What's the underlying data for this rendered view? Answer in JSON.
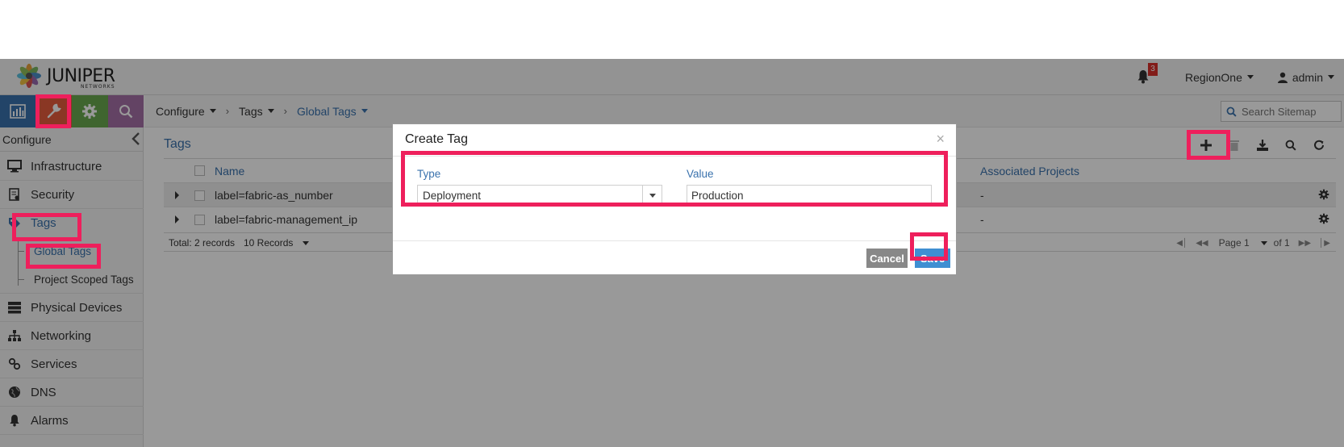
{
  "header": {
    "brand": "JUNIPER",
    "brand_sub": "NETWORKS",
    "notification_count": "3",
    "region": "RegionOne",
    "user": "admin"
  },
  "sidebar": {
    "title": "Configure",
    "items": [
      {
        "label": "Infrastructure",
        "icon": "monitor-icon"
      },
      {
        "label": "Security",
        "icon": "shield-doc-icon"
      },
      {
        "label": "Tags",
        "icon": "tag-icon"
      },
      {
        "label": "Physical Devices",
        "icon": "server-icon"
      },
      {
        "label": "Networking",
        "icon": "network-icon"
      },
      {
        "label": "Services",
        "icon": "link-icon"
      },
      {
        "label": "DNS",
        "icon": "globe-icon"
      },
      {
        "label": "Alarms",
        "icon": "bell-icon"
      }
    ],
    "tags_children": [
      "Global Tags",
      "Project Scoped Tags"
    ]
  },
  "breadcrumb": {
    "items": [
      "Configure",
      "Tags",
      "Global Tags"
    ]
  },
  "search": {
    "placeholder": "Search Sitemap"
  },
  "grid": {
    "title": "Tags",
    "columns": {
      "name": "Name",
      "associated_projects": "Associated Projects"
    },
    "rows": [
      {
        "name": "label=fabric-as_number",
        "associated_projects": "-"
      },
      {
        "name": "label=fabric-management_ip",
        "associated_projects": "-"
      }
    ],
    "footer": {
      "total": "Total: 2 records",
      "page_size": "10 Records",
      "page": "Page 1",
      "of": "of 1"
    }
  },
  "modal": {
    "title": "Create Tag",
    "close": "×",
    "type_label": "Type",
    "type_value": "Deployment",
    "value_label": "Value",
    "value_value": "Production",
    "cancel": "Cancel",
    "save": "Save"
  },
  "colors": {
    "accent": "#3a72ad",
    "highlight": "#ee1f5c",
    "save": "#3f8fd2",
    "cancel": "#888888",
    "tab_monitor": "#3a72ad",
    "tab_configure": "#e65c3d",
    "tab_settings": "#6aa84f",
    "tab_query": "#a571a7"
  }
}
